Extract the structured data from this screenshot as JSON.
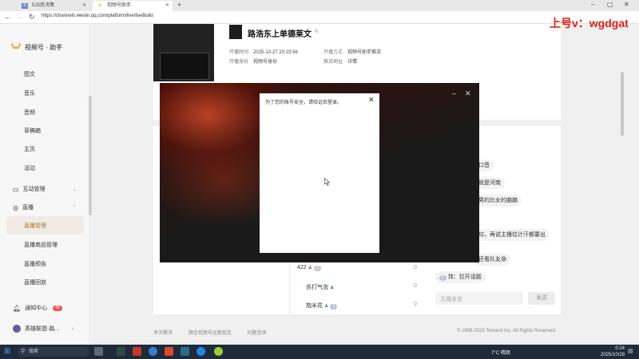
{
  "browser": {
    "tabs": [
      {
        "label": "515恐决策",
        "active": false
      },
      {
        "label": "视频号助手",
        "active": true
      }
    ],
    "url": "https://channels.weixin.qq.com/platform/live/liveBuild"
  },
  "sidebar": {
    "brand": "视频号 · 助手",
    "items": [
      "图文",
      "音乐",
      "音频",
      "草稿箱",
      "主页",
      "活动"
    ],
    "interaction_group": "互动管理",
    "live_group": "直播",
    "live_items": [
      "直播管理",
      "直播商品管理",
      "直播预告",
      "直播回放"
    ],
    "notification": "通知中心",
    "notification_badge": "44",
    "account": "英雄联盟-路..."
  },
  "live": {
    "title": "路浩东上单德莱文",
    "start_time_label": "开播时间",
    "start_time": "2025-10-27 20:23:56",
    "identity_label": "开播身份",
    "identity": "视频号身份",
    "method_label": "开播方式",
    "method": "视频号助手推流",
    "push_label": "推流地址",
    "push_value": "详情"
  },
  "chat": {
    "messages": [
      "口音",
      "就是河南",
      "男的比女的脑腩",
      "句，再说主播估计汗都要出",
      "还看队友😄",
      "拉开话题"
    ],
    "last_prefix_badge": "1",
    "last_user": "玮",
    "input_placeholder": "主播发言",
    "send_label": "发送"
  },
  "viewers": [
    {
      "name": "422",
      "badge": "2",
      "count": "0"
    },
    {
      "name": "苏打气泡",
      "badge": "",
      "count": "0"
    },
    {
      "name": "抱米花",
      "badge": "3",
      "count": "0"
    }
  ],
  "footer": {
    "links": [
      "关于腾讯",
      "微信视频号运营规范",
      "问题咨询"
    ],
    "copyright": "© 1998-2025 Tencent Inc. All Rights Reserved."
  },
  "overlay": {
    "watermark": "上号v：wgdgat",
    "login_message": "为了您的账号安全，请验证后登录。"
  },
  "taskbar": {
    "search_placeholder": "搜索",
    "weather": "7°C 晴朗",
    "time": "0:24",
    "date": "2025/10/28"
  },
  "colors": {
    "brand": "#fa9d3b",
    "badge": "#fa5151",
    "watermark": "#e0201a"
  }
}
